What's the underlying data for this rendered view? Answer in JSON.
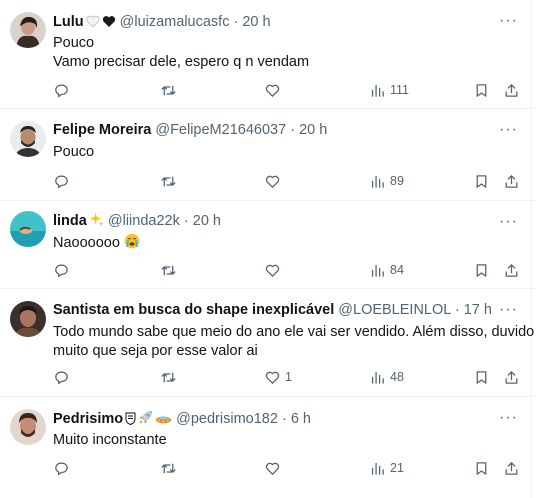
{
  "tweets": [
    {
      "name": "Lulu",
      "handle": "@luizamalucasfc",
      "time": "20 h",
      "lines": [
        "Pouco",
        "Vamo precisar dele, espero q n vendam"
      ],
      "likes": "",
      "views": "111",
      "avatar": "avatar-lulu"
    },
    {
      "name": "Felipe Moreira",
      "handle": "@FelipeM21646037",
      "time": "20 h",
      "lines": [
        "Pouco"
      ],
      "likes": "",
      "views": "89",
      "avatar": "avatar-felipe"
    },
    {
      "name": "linda",
      "handle": "@liinda22k",
      "time": "20 h",
      "lines": [
        "Naoooooo"
      ],
      "likes": "",
      "views": "84",
      "avatar": "avatar-linda"
    },
    {
      "name": "Santista em busca do shape inexplicável",
      "handle": "@LOEBLEINLOL",
      "time": "17 h",
      "lines": [
        "Todo mundo sabe que meio do ano ele vai ser vendido. Além disso, duvido",
        "muito que seja por esse valor ai"
      ],
      "likes": "1",
      "views": "48",
      "avatar": "avatar-santista"
    },
    {
      "name": "Pedrisimo",
      "handle": "@pedrisimo182",
      "time": "6 h",
      "lines": [
        "Muito inconstante"
      ],
      "likes": "",
      "views": "21",
      "avatar": "avatar-pedrisimo"
    }
  ],
  "decorations": {
    "lulu": [
      "white-heart-icon",
      "black-heart-icon"
    ],
    "linda": [
      "sparkles-icon"
    ],
    "linda_body": [
      "crying-face-icon"
    ],
    "pedrisimo": [
      "santos-badge-icon",
      "rocket-icon",
      "flying-saucer-icon"
    ]
  },
  "separator": "·",
  "colors": {
    "text": "#0f1419",
    "secondary": "#536471",
    "border": "#eff3f4"
  }
}
